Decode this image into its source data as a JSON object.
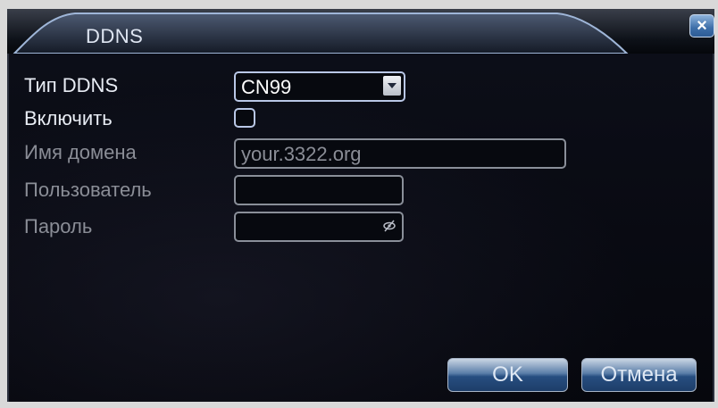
{
  "window": {
    "title": "DDNS",
    "close_glyph": "×"
  },
  "form": {
    "type_label": "Тип DDNS",
    "type_value": "CN99",
    "enable_label": "Включить",
    "enable_checked": false,
    "domain_label": "Имя домена",
    "domain_value": "your.3322.org",
    "user_label": "Пользователь",
    "user_value": "",
    "password_label": "Пароль",
    "password_value": ""
  },
  "buttons": {
    "ok_label": "OK",
    "cancel_label": "Отмена"
  },
  "icons": {
    "close": "close-icon",
    "dropdown": "chevron-down-icon",
    "password_toggle": "eye-slash-icon"
  },
  "colors": {
    "panel_bg": "#06070d",
    "accent_blue": "#3d6ea8",
    "enabled_text": "#e8ecf4",
    "disabled_text": "#8a8d96"
  }
}
